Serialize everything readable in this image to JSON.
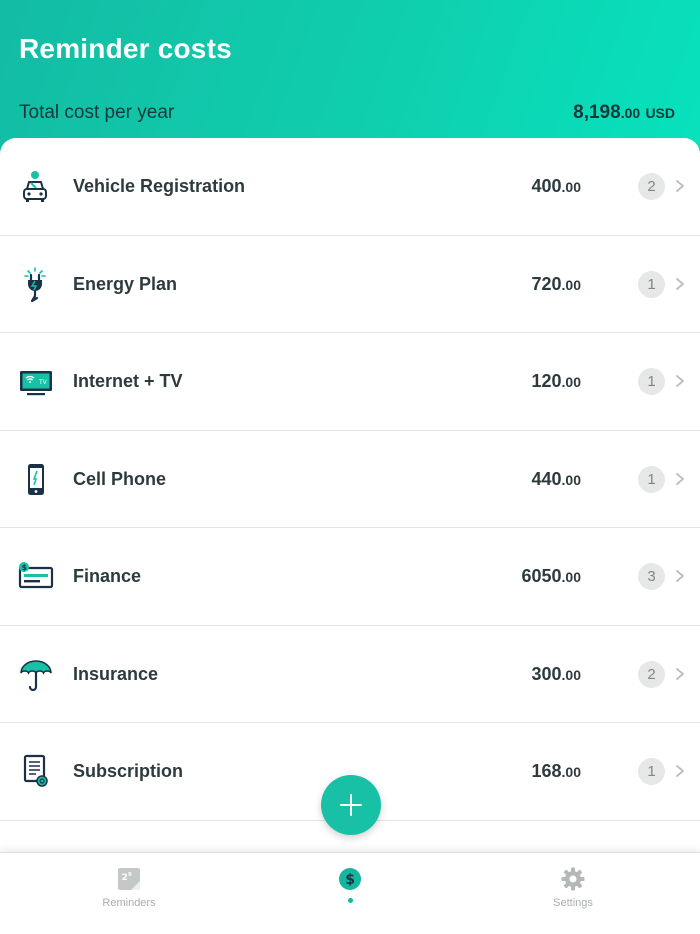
{
  "header": {
    "title": "Reminder costs",
    "total_label": "Total cost per year",
    "total_main": "8,198",
    "total_cents": ".00",
    "total_currency": "USD"
  },
  "items": [
    {
      "name": "Vehicle Registration",
      "amount_main": "400",
      "amount_cents": ".00",
      "count": "2",
      "icon": "car-icon"
    },
    {
      "name": "Energy Plan",
      "amount_main": "720",
      "amount_cents": ".00",
      "count": "1",
      "icon": "power-plug-icon"
    },
    {
      "name": "Internet + TV",
      "amount_main": "120",
      "amount_cents": ".00",
      "count": "1",
      "icon": "tv-icon"
    },
    {
      "name": "Cell Phone",
      "amount_main": "440",
      "amount_cents": ".00",
      "count": "1",
      "icon": "cell-phone-icon"
    },
    {
      "name": "Finance",
      "amount_main": "6050",
      "amount_cents": ".00",
      "count": "3",
      "icon": "cheque-icon"
    },
    {
      "name": "Insurance",
      "amount_main": "300",
      "amount_cents": ".00",
      "count": "2",
      "icon": "umbrella-icon"
    },
    {
      "name": "Subscription",
      "amount_main": "168",
      "amount_cents": ".00",
      "count": "1",
      "icon": "document-icon"
    }
  ],
  "fab": {
    "icon": "plus-icon"
  },
  "tabs": [
    {
      "label": "Reminders",
      "icon": "calendar-icon"
    },
    {
      "label": "",
      "icon": "dollar-icon",
      "active": true
    },
    {
      "label": "Settings",
      "icon": "gear-icon"
    }
  ],
  "colors": {
    "accent": "#18c1a6",
    "header_start": "#13bca4",
    "header_end": "#07e2bd",
    "text_dark": "#2d3b3f",
    "icon_navy": "#1b3148",
    "badge_bg": "#e6e8e8"
  }
}
